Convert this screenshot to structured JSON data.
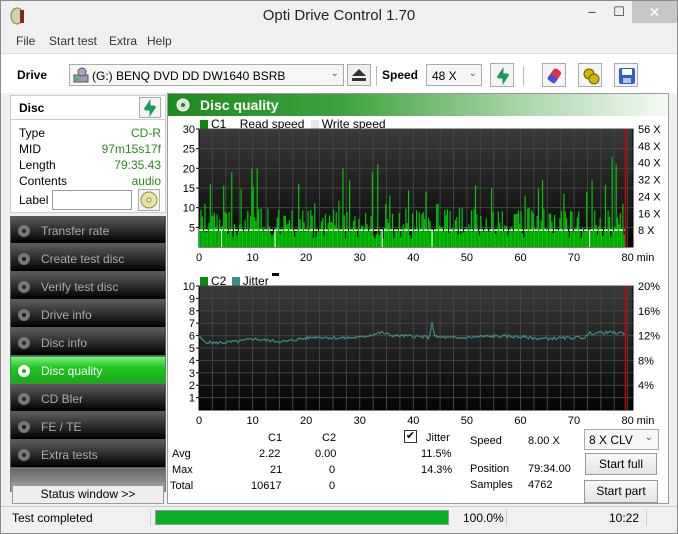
{
  "window": {
    "title": "Opti Drive Control 1.70",
    "controls": {
      "minimize": "–",
      "maximize": "☐",
      "close": "✕"
    }
  },
  "menu": [
    "File",
    "Start test",
    "Extra",
    "Help"
  ],
  "toolbar": {
    "drive_label": "Drive",
    "drive_value": "(G:)   BENQ DVD DD DW1640 BSRB",
    "speed_label": "Speed",
    "speed_value": "48 X",
    "icons": [
      "eject-icon",
      "refresh-icon",
      "erase-icon",
      "settings-icon",
      "save-icon"
    ]
  },
  "disc": {
    "header": "Disc",
    "fields": [
      {
        "key": "Type",
        "value": "CD-R"
      },
      {
        "key": "MID",
        "value": "97m15s17f"
      },
      {
        "key": "Length",
        "value": "79:35.43"
      },
      {
        "key": "Contents",
        "value": "audio"
      }
    ],
    "label_key": "Label",
    "label_value": ""
  },
  "nav": {
    "items": [
      {
        "label": "Transfer rate",
        "active": false
      },
      {
        "label": "Create test disc",
        "active": false
      },
      {
        "label": "Verify test disc",
        "active": false
      },
      {
        "label": "Drive info",
        "active": false
      },
      {
        "label": "Disc info",
        "active": false
      },
      {
        "label": "Disc quality",
        "active": true
      },
      {
        "label": "CD Bler",
        "active": false
      },
      {
        "label": "FE / TE",
        "active": false
      },
      {
        "label": "Extra tests",
        "active": false
      }
    ],
    "status_window": "Status window >>"
  },
  "panel": {
    "title": "Disc quality",
    "legend_top": {
      "c1": "C1",
      "read": "Read speed",
      "write": "Write speed"
    },
    "legend_bottom": {
      "c2": "C2",
      "jitter": "Jitter"
    },
    "colors": {
      "c1": "#00c800",
      "c2": "#007a00",
      "jitter": "#3c8c8c",
      "marker": "#d40000"
    }
  },
  "chart_data": [
    {
      "type": "bar",
      "title": "C1 / Read speed",
      "xlabel": "min",
      "xlim": [
        0,
        81
      ],
      "xticks": [
        0,
        10,
        20,
        30,
        40,
        50,
        60,
        70,
        80
      ],
      "ylim": [
        0,
        30
      ],
      "yticks": [
        5,
        10,
        15,
        20,
        25,
        30
      ],
      "y2ticks": [
        "8 X",
        "16 X",
        "24 X",
        "32 X",
        "40 X",
        "48 X",
        "56 X"
      ],
      "y2lim": [
        0,
        56
      ],
      "grid": true,
      "series": [
        {
          "name": "C1",
          "summary": {
            "avg": 2.22,
            "max": 21,
            "total": 10617
          },
          "baseline": 4,
          "peaks": [
            [
              1.0,
              11
            ],
            [
              2.5,
              8
            ],
            [
              5.9,
              19
            ],
            [
              9.8,
              20
            ],
            [
              10.8,
              20
            ],
            [
              18.4,
              16
            ],
            [
              26.7,
              20
            ],
            [
              28.0,
              17
            ],
            [
              32.3,
              19
            ],
            [
              33.3,
              21
            ],
            [
              34.8,
              11
            ],
            [
              44.5,
              11
            ],
            [
              49.0,
              10
            ],
            [
              54.6,
              15
            ],
            [
              60.8,
              13
            ],
            [
              64.0,
              17
            ],
            [
              68.2,
              9
            ],
            [
              73.3,
              17
            ],
            [
              76.9,
              23
            ],
            [
              77.8,
              21
            ],
            [
              78.9,
              11
            ]
          ]
        },
        {
          "name": "Read speed",
          "value_x": 8.0
        }
      ],
      "end_marker_x": 79.6
    },
    {
      "type": "line",
      "title": "C2 / Jitter",
      "xlabel": "min",
      "xlim": [
        0,
        81
      ],
      "xticks": [
        0,
        10,
        20,
        30,
        40,
        50,
        60,
        70,
        80
      ],
      "ylim": [
        0,
        10
      ],
      "yticks": [
        1,
        2,
        3,
        4,
        5,
        6,
        7,
        8,
        9,
        10
      ],
      "y2ticks": [
        "4%",
        "8%",
        "12%",
        "16%",
        "20%"
      ],
      "y2lim": [
        0,
        20
      ],
      "grid": true,
      "series": [
        {
          "name": "C2",
          "summary": {
            "avg": 0.0,
            "max": 0,
            "total": 0
          }
        },
        {
          "name": "Jitter",
          "unit": "%",
          "summary": {
            "avg": 11.5,
            "max": 14.3
          },
          "points": [
            [
              0,
              11.8
            ],
            [
              1,
              11.0
            ],
            [
              3,
              10.8
            ],
            [
              5,
              10.9
            ],
            [
              8,
              11.1
            ],
            [
              10,
              11.5
            ],
            [
              13,
              11.2
            ],
            [
              16,
              11.0
            ],
            [
              19,
              11.5
            ],
            [
              22,
              11.8
            ],
            [
              26,
              11.6
            ],
            [
              30,
              11.7
            ],
            [
              33,
              12.3
            ],
            [
              34.2,
              12.5
            ],
            [
              36,
              12.0
            ],
            [
              40,
              11.9
            ],
            [
              43,
              11.7
            ],
            [
              43.5,
              14.3
            ],
            [
              44,
              11.8
            ],
            [
              48,
              11.6
            ],
            [
              52,
              11.8
            ],
            [
              56,
              11.9
            ],
            [
              60,
              11.8
            ],
            [
              64,
              11.5
            ],
            [
              68,
              11.6
            ],
            [
              72,
              11.7
            ],
            [
              73,
              12.4
            ],
            [
              76,
              12.5
            ],
            [
              79.6,
              12.4
            ]
          ]
        }
      ],
      "end_marker_x": 79.6
    }
  ],
  "stats": {
    "col_c1": "C1",
    "col_c2": "C2",
    "jitter_label": "Jitter",
    "jitter_checked": true,
    "rows": [
      {
        "label": "Avg",
        "c1": "2.22",
        "c2": "0.00",
        "jitter": "11.5%"
      },
      {
        "label": "Max",
        "c1": "21",
        "c2": "0",
        "jitter": "14.3%"
      },
      {
        "label": "Total",
        "c1": "10617",
        "c2": "0",
        "jitter": ""
      }
    ],
    "speed_label": "Speed",
    "speed_value": "8.00 X",
    "position_label": "Position",
    "position_value": "79:34.00",
    "samples_label": "Samples",
    "samples_value": "4762",
    "mode_value": "8 X CLV",
    "start_full": "Start full",
    "start_part": "Start part"
  },
  "statusbar": {
    "text": "Test completed",
    "progress": 1.0,
    "percent_text": "100.0%",
    "time": "10:22"
  }
}
